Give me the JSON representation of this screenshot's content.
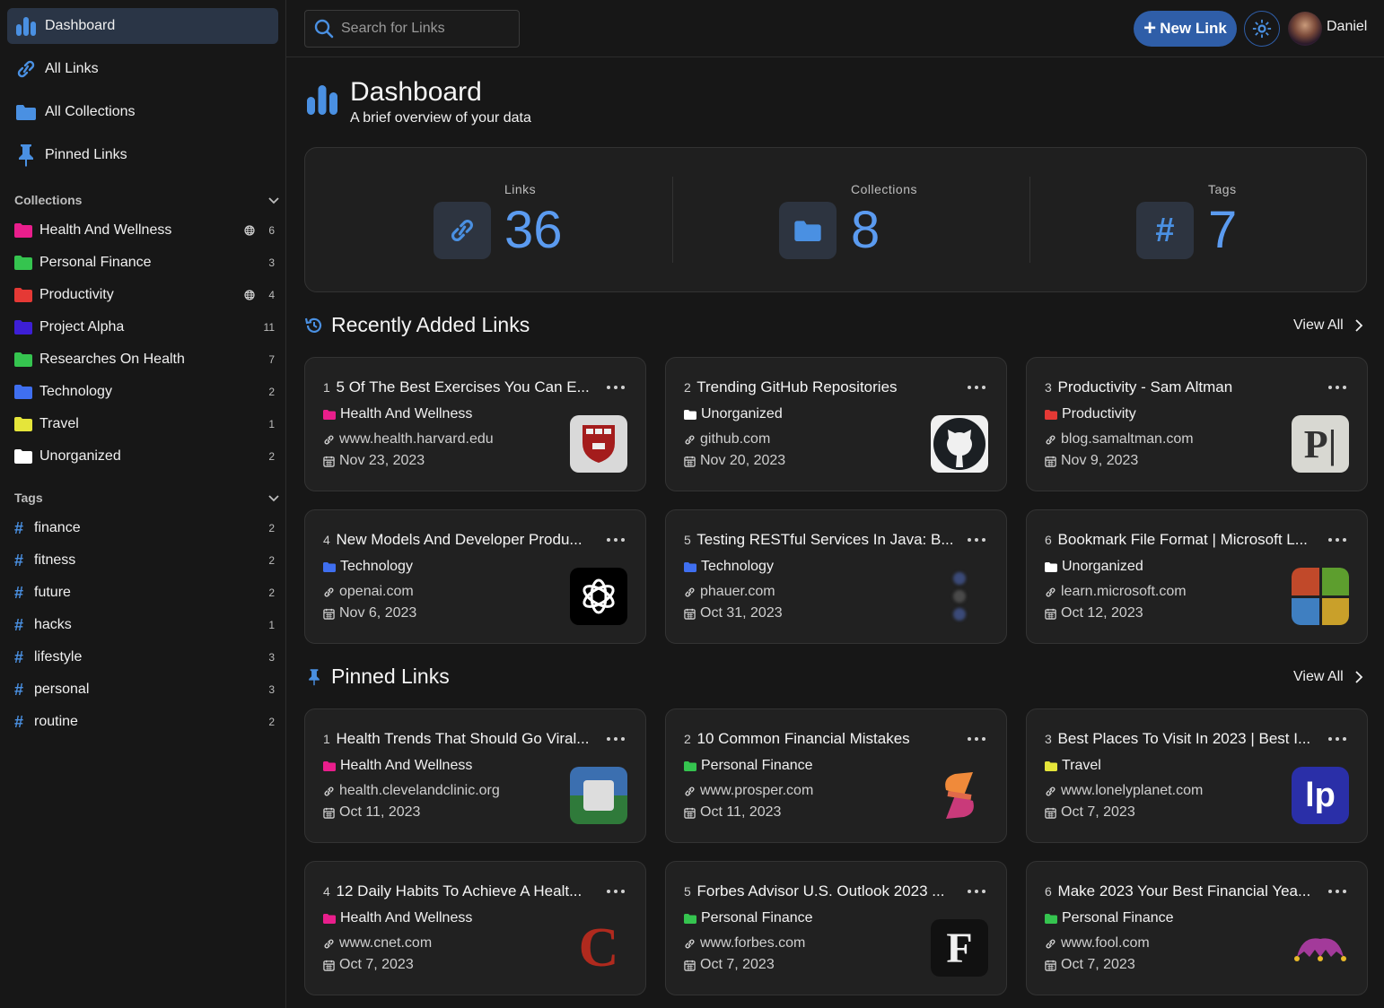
{
  "sidebar": {
    "nav": [
      {
        "label": "Dashboard",
        "icon": "bar-chart-icon",
        "active": true
      },
      {
        "label": "All Links",
        "icon": "link-icon"
      },
      {
        "label": "All Collections",
        "icon": "folder-icon"
      },
      {
        "label": "Pinned Links",
        "icon": "pin-icon"
      }
    ],
    "collections_heading": "Collections",
    "collections": [
      {
        "label": "Health And Wellness",
        "count": "6",
        "color": "#e91e8c",
        "public": true
      },
      {
        "label": "Personal Finance",
        "count": "3",
        "color": "#35c44f",
        "public": false
      },
      {
        "label": "Productivity",
        "count": "4",
        "color": "#e53935",
        "public": true
      },
      {
        "label": "Project Alpha",
        "count": "11",
        "color": "#3d1fd6",
        "public": false
      },
      {
        "label": "Researches On Health",
        "count": "7",
        "color": "#35c44f",
        "public": false
      },
      {
        "label": "Technology",
        "count": "2",
        "color": "#3f6ff0",
        "public": false
      },
      {
        "label": "Travel",
        "count": "1",
        "color": "#e5e53a",
        "public": false
      },
      {
        "label": "Unorganized",
        "count": "2",
        "color": "#ffffff",
        "public": false
      }
    ],
    "tags_heading": "Tags",
    "tags": [
      {
        "label": "finance",
        "count": "2"
      },
      {
        "label": "fitness",
        "count": "2"
      },
      {
        "label": "future",
        "count": "2"
      },
      {
        "label": "hacks",
        "count": "1"
      },
      {
        "label": "lifestyle",
        "count": "3"
      },
      {
        "label": "personal",
        "count": "3"
      },
      {
        "label": "routine",
        "count": "2"
      }
    ]
  },
  "topbar": {
    "search_placeholder": "Search for Links",
    "new_link_label": "New Link",
    "user_name": "Daniel"
  },
  "header": {
    "title": "Dashboard",
    "subtitle": "A brief overview of your data"
  },
  "stats": [
    {
      "label": "Links",
      "value": "36",
      "icon": "link-icon"
    },
    {
      "label": "Collections",
      "value": "8",
      "icon": "folder-icon"
    },
    {
      "label": "Tags",
      "value": "7",
      "icon": "hash-icon"
    }
  ],
  "recent": {
    "title": "Recently Added Links",
    "view_all": "View All",
    "cards": [
      {
        "idx": "1",
        "title": "5 Of The Best Exercises You Can E...",
        "collection": "Health And Wellness",
        "color": "#e91e8c",
        "url": "www.health.harvard.edu",
        "date": "Nov 23, 2023",
        "thumb": "harvard-shield-icon"
      },
      {
        "idx": "2",
        "title": "Trending GitHub Repositories",
        "collection": "Unorganized",
        "color": "#ffffff",
        "url": "github.com",
        "date": "Nov 20, 2023",
        "thumb": "github-icon"
      },
      {
        "idx": "3",
        "title": "Productivity - Sam Altman",
        "collection": "Productivity",
        "color": "#e53935",
        "url": "blog.samaltman.com",
        "date": "Nov 9, 2023",
        "thumb": "p-logo-icon"
      },
      {
        "idx": "4",
        "title": "New Models And Developer Produ...",
        "collection": "Technology",
        "color": "#3f6ff0",
        "url": "openai.com",
        "date": "Nov 6, 2023",
        "thumb": "openai-icon"
      },
      {
        "idx": "5",
        "title": "Testing RESTful Services In Java: B...",
        "collection": "Technology",
        "color": "#3f6ff0",
        "url": "phauer.com",
        "date": "Oct 31, 2023",
        "thumb": "phauer-icon"
      },
      {
        "idx": "6",
        "title": "Bookmark File Format | Microsoft L...",
        "collection": "Unorganized",
        "color": "#ffffff",
        "url": "learn.microsoft.com",
        "date": "Oct 12, 2023",
        "thumb": "microsoft-icon"
      }
    ]
  },
  "pinned": {
    "title": "Pinned Links",
    "view_all": "View All",
    "cards": [
      {
        "idx": "1",
        "title": "Health Trends That Should Go Viral...",
        "collection": "Health And Wellness",
        "color": "#e91e8c",
        "url": "health.clevelandclinic.org",
        "date": "Oct 11, 2023",
        "thumb": "cleveland-clinic-icon"
      },
      {
        "idx": "2",
        "title": "10 Common Financial Mistakes",
        "collection": "Personal Finance",
        "color": "#35c44f",
        "url": "www.prosper.com",
        "date": "Oct 11, 2023",
        "thumb": "prosper-icon"
      },
      {
        "idx": "3",
        "title": "Best Places To Visit In 2023 | Best I...",
        "collection": "Travel",
        "color": "#e5e53a",
        "url": "www.lonelyplanet.com",
        "date": "Oct 7, 2023",
        "thumb": "lonely-planet-icon"
      },
      {
        "idx": "4",
        "title": "12 Daily Habits To Achieve A Healt...",
        "collection": "Health And Wellness",
        "color": "#e91e8c",
        "url": "www.cnet.com",
        "date": "Oct 7, 2023",
        "thumb": "cnet-icon"
      },
      {
        "idx": "5",
        "title": "Forbes Advisor U.S. Outlook 2023 ...",
        "collection": "Personal Finance",
        "color": "#35c44f",
        "url": "www.forbes.com",
        "date": "Oct 7, 2023",
        "thumb": "forbes-icon"
      },
      {
        "idx": "6",
        "title": "Make 2023 Your Best Financial Yea...",
        "collection": "Personal Finance",
        "color": "#35c44f",
        "url": "www.fool.com",
        "date": "Oct 7, 2023",
        "thumb": "motley-fool-icon"
      }
    ]
  },
  "colors": {
    "accent": "#2f5ea8",
    "accent_light": "#5b9bf0",
    "active_nav": "#2a3546"
  }
}
